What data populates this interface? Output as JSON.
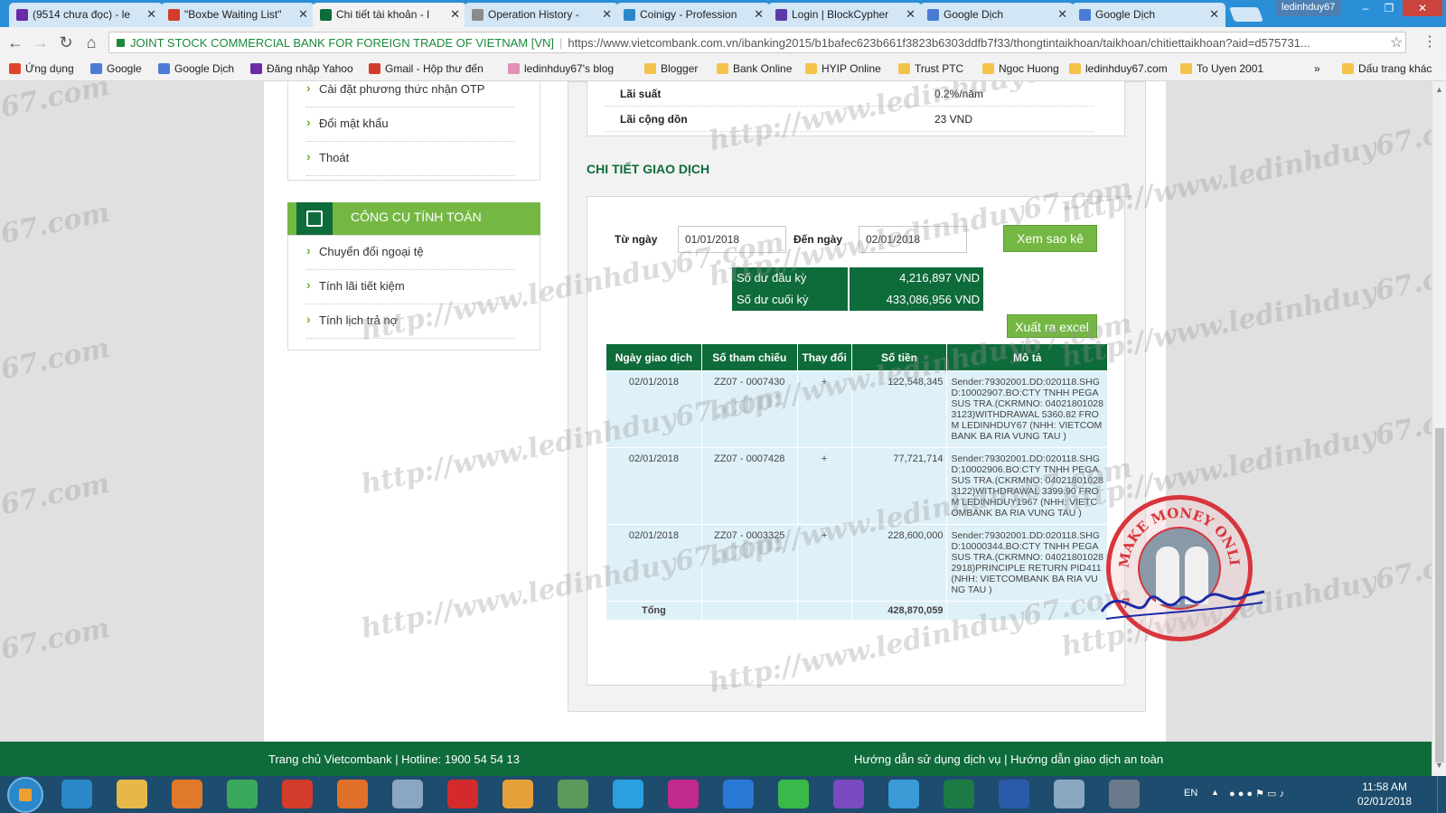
{
  "browser": {
    "tabs": [
      {
        "title": "(9514 chưa đọc) - le",
        "color": "#6b2aa8"
      },
      {
        "title": "\"Boxbe Waiting List\"",
        "color": "#d33b2b"
      },
      {
        "title": "Chi tiết tài khoản - I",
        "color": "#0e6b3a"
      },
      {
        "title": "Operation History -",
        "color": "#8a8a8a"
      },
      {
        "title": "Coinigy - Profession",
        "color": "#2a88c9"
      },
      {
        "title": "Login | BlockCypher",
        "color": "#5a3aa8"
      },
      {
        "title": "Google Dịch",
        "color": "#4a7cd6"
      },
      {
        "title": "Google Dịch",
        "color": "#4a7cd6"
      }
    ],
    "profile_name": "ledinhduy67",
    "secure_label": "JOINT STOCK COMMERCIAL BANK FOR FOREIGN TRADE OF VIETNAM [VN]",
    "url": "https://www.vietcombank.com.vn/ibanking2015/b1bafec623b661f3823b6303ddfb7f33/thongtintaikhoan/taikhoan/chitiettaikhoan?aid=d575731...",
    "bookmarks": [
      {
        "label": "Ứng dụng",
        "color": "#e0442c"
      },
      {
        "label": "Google",
        "color": "#4a7cd6"
      },
      {
        "label": "Google Dịch",
        "color": "#4a7cd6"
      },
      {
        "label": "Đăng nhập Yahoo",
        "color": "#6b2aa8"
      },
      {
        "label": "Gmail - Hộp thư đến",
        "color": "#d33b2b"
      },
      {
        "label": "ledinhduy67's blog",
        "color": "#e08fb8"
      },
      {
        "label": "Blogger",
        "color": "#f3c34b"
      },
      {
        "label": "Bank Online",
        "color": "#f3c34b"
      },
      {
        "label": "HYIP Online",
        "color": "#f3c34b"
      },
      {
        "label": "Trust PTC",
        "color": "#f3c34b"
      },
      {
        "label": "Ngoc Huong",
        "color": "#f3c34b"
      },
      {
        "label": "ledinhduy67.com",
        "color": "#f3c34b"
      },
      {
        "label": "To Uyen 2001",
        "color": "#f3c34b"
      }
    ],
    "bookmarks_overflow": "»",
    "other_bookmarks": "Dấu trang khác"
  },
  "sidebar": {
    "account_links": [
      "Cài đặt phương thức nhận OTP",
      "Đổi mật khẩu",
      "Thoát"
    ],
    "tools_title": "CÔNG CỤ TÍNH TOÁN",
    "tools_links": [
      "Chuyển đổi ngoại tệ",
      "Tính lãi tiết kiệm",
      "Tính lịch trả nợ"
    ]
  },
  "account_info": {
    "rows": [
      {
        "label": "Lãi suất",
        "value": "0.2%/năm"
      },
      {
        "label": "Lãi cộng dồn",
        "value": "23 VND"
      }
    ]
  },
  "transactions": {
    "section_title": "CHI TIẾT GIAO DỊCH",
    "from_label": "Từ ngày",
    "from_value": "01/01/2018",
    "to_label": "Đến ngày",
    "to_value": "02/01/2018",
    "view_button": "Xem sao kê",
    "opening_label": "Số dư đầu kỳ",
    "opening_value": "4,216,897 VND",
    "closing_label": "Số dư cuối kỳ",
    "closing_value": "433,086,956 VND",
    "export_button": "Xuất ra excel",
    "columns": [
      "Ngày giao dịch",
      "Số tham chiếu",
      "Thay đổi",
      "Số tiền",
      "Mô tả"
    ],
    "rows": [
      {
        "date": "02/01/2018",
        "ref": "ZZ07 - 0007430",
        "change": "+",
        "amount": "122,548,345",
        "desc": "Sender:79302001.DD:020118.SHGD:10002907.BO:CTY TNHH PEGASUS TRA.(CKRMNO: 040218010283123)WITHDRAWAL 5360.82 FROM LEDINHDUY67 (NHH: VIETCOMBANK BA RIA VUNG TAU )"
      },
      {
        "date": "02/01/2018",
        "ref": "ZZ07 - 0007428",
        "change": "+",
        "amount": "77,721,714",
        "desc": "Sender:79302001.DD:020118.SHGD:10002906.BO:CTY TNHH PEGASUS TRA.(CKRMNO: 040218010283122)WITHDRAWAL 3399.90 FROM LEDINHDUY1967 (NHH: VIETCOMBANK BA RIA VUNG TAU )"
      },
      {
        "date": "02/01/2018",
        "ref": "ZZ07 - 0003325",
        "change": "+",
        "amount": "228,600,000",
        "desc": "Sender:79302001.DD:020118.SHGD:10000344.BO:CTY TNHH PEGASUS TRA.(CKRMNO: 040218010282918)PRINCIPLE RETURN PID411 (NHH: VIETCOMBANK BA RIA VUNG TAU )"
      }
    ],
    "total_label": "Tổng",
    "total_amount": "428,870,059"
  },
  "footer": {
    "left": "Trang chủ Vietcombank | Hotline: 1900 54 54 13",
    "right": "Hướng dẫn sử dụng dịch vụ |  Hướng dẫn giao dịch an toàn"
  },
  "watermark": {
    "text_long": "http://www.ledinhduy67.com",
    "text_short": "67.com"
  },
  "stamp": {
    "ring_text": "MAKE MONEY ONLINE",
    "number": "7"
  },
  "taskbar": {
    "lang": "EN",
    "time": "11:58 AM",
    "date": "02/01/2018",
    "apps": [
      {
        "name": "internet-explorer-icon",
        "color": "#2a88c9"
      },
      {
        "name": "file-explorer-icon",
        "color": "#e6b84a"
      },
      {
        "name": "media-player-icon",
        "color": "#e07a2a"
      },
      {
        "name": "chrome-icon",
        "color": "#3aa85a"
      },
      {
        "name": "unikey-icon",
        "color": "#d33b2b"
      },
      {
        "name": "firefox-icon",
        "color": "#e0702a"
      },
      {
        "name": "chrome-canary-icon",
        "color": "#8aa6c0"
      },
      {
        "name": "opera-icon",
        "color": "#d32b2b"
      },
      {
        "name": "coccoc-icon",
        "color": "#e6a03a"
      },
      {
        "name": "sync-icon",
        "color": "#5a9a5a"
      },
      {
        "name": "skype-icon",
        "color": "#2aa0e0"
      },
      {
        "name": "wallet-icon",
        "color": "#c02a8a"
      },
      {
        "name": "zalo-icon",
        "color": "#2a78d6"
      },
      {
        "name": "flower-icon",
        "color": "#3ab84a"
      },
      {
        "name": "viber-icon",
        "color": "#7a4ac0"
      },
      {
        "name": "telegram-icon",
        "color": "#3a9ad6"
      },
      {
        "name": "excel-icon",
        "color": "#1d7a45"
      },
      {
        "name": "word-icon",
        "color": "#2a5aa8"
      },
      {
        "name": "notes-icon",
        "color": "#8aa8c0"
      },
      {
        "name": "calculator-icon",
        "color": "#6a7a8a"
      }
    ]
  }
}
